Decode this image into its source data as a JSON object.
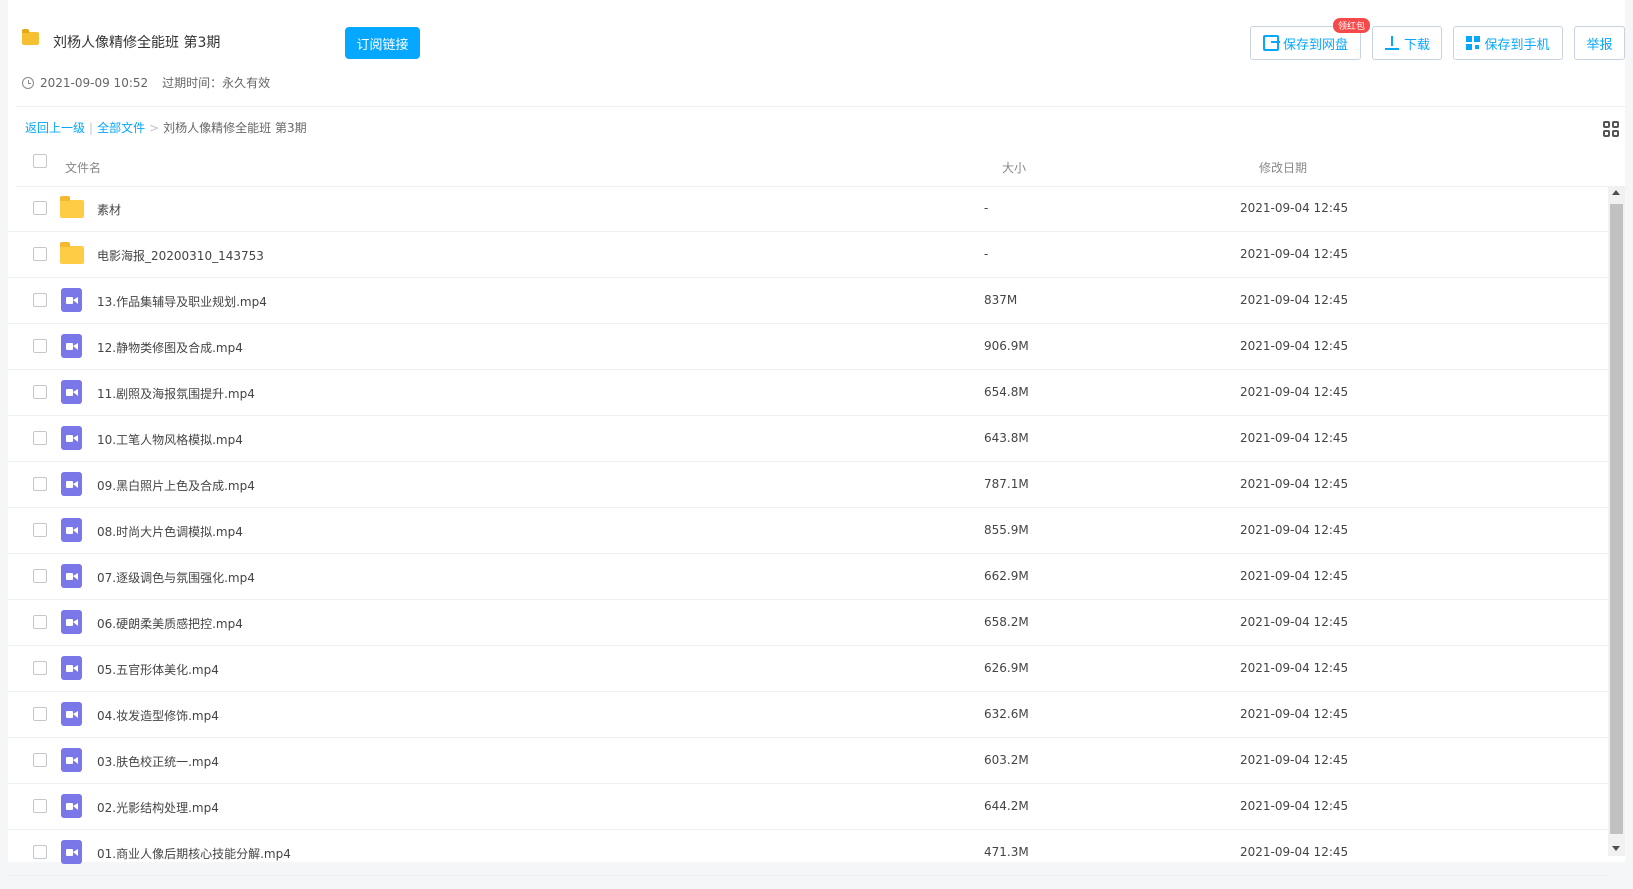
{
  "header": {
    "title": "刘杨人像精修全能班 第3期",
    "subscribe_label": "订阅链接",
    "created": "2021-09-09 10:52",
    "expire": "过期时间：永久有效",
    "badge": "领红包"
  },
  "actions": {
    "save_to_pan": "保存到网盘",
    "download": "下载",
    "save_to_phone": "保存到手机",
    "report": "举报"
  },
  "breadcrumb": {
    "back": "返回上一级",
    "all_files": "全部文件",
    "current": "刘杨人像精修全能班 第3期"
  },
  "columns": {
    "name": "文件名",
    "size": "大小",
    "date": "修改日期"
  },
  "files": [
    {
      "type": "folder",
      "name": "素材",
      "size": "-",
      "date": "2021-09-04 12:45"
    },
    {
      "type": "folder",
      "name": "电影海报_20200310_143753",
      "size": "-",
      "date": "2021-09-04 12:45"
    },
    {
      "type": "video",
      "name": "13.作品集辅导及职业规划.mp4",
      "size": "837M",
      "date": "2021-09-04 12:45"
    },
    {
      "type": "video",
      "name": "12.静物类修图及合成.mp4",
      "size": "906.9M",
      "date": "2021-09-04 12:45"
    },
    {
      "type": "video",
      "name": "11.剧照及海报氛围提升.mp4",
      "size": "654.8M",
      "date": "2021-09-04 12:45"
    },
    {
      "type": "video",
      "name": "10.工笔人物风格模拟.mp4",
      "size": "643.8M",
      "date": "2021-09-04 12:45"
    },
    {
      "type": "video",
      "name": "09.黑白照片上色及合成.mp4",
      "size": "787.1M",
      "date": "2021-09-04 12:45"
    },
    {
      "type": "video",
      "name": "08.时尚大片色调模拟.mp4",
      "size": "855.9M",
      "date": "2021-09-04 12:45"
    },
    {
      "type": "video",
      "name": "07.逐级调色与氛围强化.mp4",
      "size": "662.9M",
      "date": "2021-09-04 12:45"
    },
    {
      "type": "video",
      "name": "06.硬朗柔美质感把控.mp4",
      "size": "658.2M",
      "date": "2021-09-04 12:45"
    },
    {
      "type": "video",
      "name": "05.五官形体美化.mp4",
      "size": "626.9M",
      "date": "2021-09-04 12:45"
    },
    {
      "type": "video",
      "name": "04.妆发造型修饰.mp4",
      "size": "632.6M",
      "date": "2021-09-04 12:45"
    },
    {
      "type": "video",
      "name": "03.肤色校正统一.mp4",
      "size": "603.2M",
      "date": "2021-09-04 12:45"
    },
    {
      "type": "video",
      "name": "02.光影结构处理.mp4",
      "size": "644.2M",
      "date": "2021-09-04 12:45"
    },
    {
      "type": "video",
      "name": "01.商业人像后期核心技能分解.mp4",
      "size": "471.3M",
      "date": "2021-09-04 12:45"
    }
  ],
  "icons": {
    "folder": "folder-icon",
    "video": "video-file-icon",
    "clock": "clock-icon",
    "grid": "grid-view-icon"
  },
  "colors": {
    "accent": "#06a7ff",
    "folder": "#ffcd45",
    "video": "#7a77e8",
    "badge": "#f64a4a"
  }
}
